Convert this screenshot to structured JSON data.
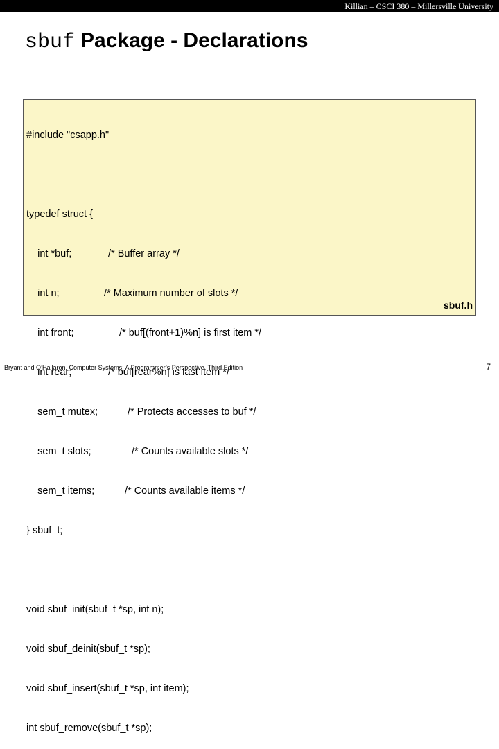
{
  "header": {
    "text": "Killian – CSCI 380 – Millersville University"
  },
  "title": {
    "mono": "sbuf",
    "rest": "Package - Declarations"
  },
  "code": {
    "include": "#include \"csapp.h\"",
    "struct_open": "typedef struct {",
    "fields": [
      {
        "decl": "    int *buf;",
        "comment": "/* Buffer array */"
      },
      {
        "decl": "    int n;",
        "comment": "/* Maximum number of slots */"
      },
      {
        "decl": "    int front;",
        "comment": "/* buf[(front+1)%n] is first item */"
      },
      {
        "decl": "    int rear;",
        "comment": "/* buf[rear%n] is last item */"
      },
      {
        "decl": "    sem_t mutex;",
        "comment": "/* Protects accesses to buf */"
      },
      {
        "decl": "    sem_t slots;",
        "comment": "/* Counts available slots */"
      },
      {
        "decl": "    sem_t items;",
        "comment": "/* Counts available items */"
      }
    ],
    "struct_close": "} sbuf_t;",
    "functions": [
      "void sbuf_init(sbuf_t *sp, int n);",
      "void sbuf_deinit(sbuf_t *sp);",
      "void sbuf_insert(sbuf_t *sp, int item);",
      "int sbuf_remove(sbuf_t *sp);"
    ],
    "file_label": "sbuf.h"
  },
  "footer": {
    "citation": "Bryant and O’Hallaron, Computer Systems: A Programmer’s Perspective, Third Edition",
    "page_number": "7"
  }
}
